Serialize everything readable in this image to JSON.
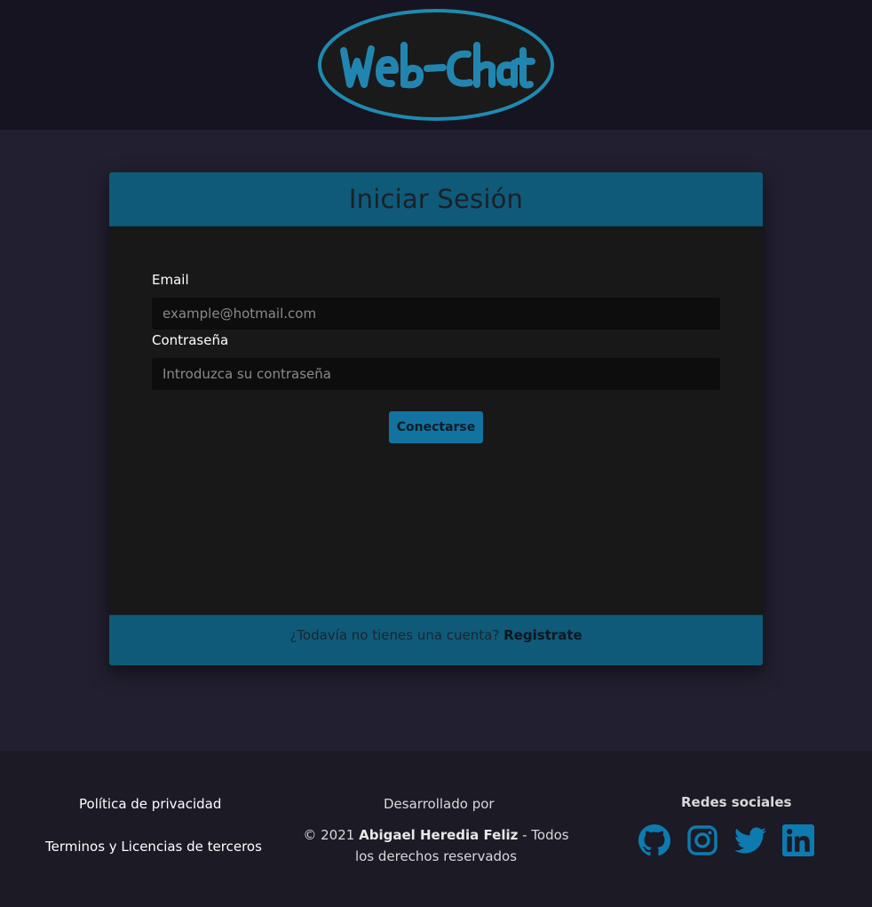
{
  "header": {
    "logo_text": "Web-Chat"
  },
  "login": {
    "title": "Iniciar Sesión",
    "email_label": "Email",
    "email_placeholder": "example@hotmail.com",
    "email_value": "",
    "password_label": "Contraseña",
    "password_placeholder": "Introduzca su contraseña",
    "password_value": "",
    "submit_label": "Conectarse",
    "footer_text": "¿Todavía no tienes una cuenta?",
    "register_link": "Registrate"
  },
  "footer": {
    "privacy_link": "Política de privacidad",
    "terms_link": "Terminos y Licencias de terceros",
    "developed_by": "Desarrollado por",
    "copyright_prefix": "© 2021",
    "author": "Abigael Heredia Feliz",
    "copyright_suffix": "- Todos los derechos reservados",
    "social_title": "Redes sociales",
    "social_icons": [
      "github-icon",
      "instagram-icon",
      "twitter-icon",
      "linkedin-icon"
    ]
  },
  "colors": {
    "accent": "#0f5a78",
    "icon_blue": "#0e7bb0",
    "button": "#1273a0",
    "page_bg": "#221f30",
    "topbar_bg": "#161421",
    "card_body": "#181818",
    "footer_bg": "#1b1a25"
  }
}
